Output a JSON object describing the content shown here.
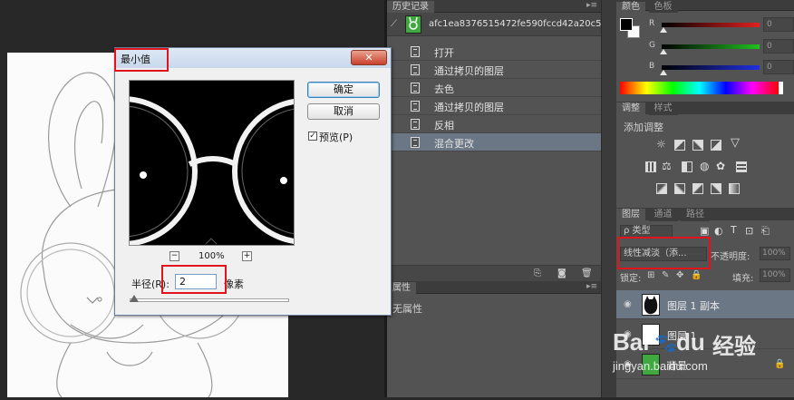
{
  "dialog": {
    "title": "最小值",
    "close_label": "✕",
    "ok_label": "确定",
    "cancel_label": "取消",
    "preview_label": "预览(P)",
    "preview_checked": true,
    "zoom_out": "−",
    "zoom_in": "+",
    "zoom_level": "100%",
    "radius_label": "半径(R):",
    "radius_value": "2",
    "radius_unit": "像素"
  },
  "history": {
    "tab_label": "历史记录",
    "snapshot_name": "afc1ea8376515472fe590fccd42a20c5_r...",
    "items": [
      {
        "label": "打开",
        "selected": false
      },
      {
        "label": "通过拷贝的图层",
        "selected": false
      },
      {
        "label": "去色",
        "selected": false
      },
      {
        "label": "通过拷贝的图层",
        "selected": false
      },
      {
        "label": "反相",
        "selected": false
      },
      {
        "label": "混合更改",
        "selected": true
      }
    ]
  },
  "properties": {
    "tab_label": "属性",
    "empty_text": "无属性"
  },
  "color_panel": {
    "tabs": [
      "颜色",
      "色板"
    ],
    "channels": [
      {
        "letter": "R",
        "value": "0",
        "color": "#e02020"
      },
      {
        "letter": "G",
        "value": "0",
        "color": "#20c020"
      },
      {
        "letter": "B",
        "value": "0",
        "color": "#2030e0"
      }
    ]
  },
  "adjustments": {
    "tabs": [
      "调整",
      "样式"
    ],
    "add_label": "添加调整"
  },
  "layers_panel": {
    "tabs": [
      "图层",
      "通道",
      "路径"
    ],
    "kind_filter": "ρ 类型",
    "blend_mode": "线性减淡（添...",
    "opacity_label": "不透明度:",
    "opacity_value": "100%",
    "lock_label": "锁定:",
    "fill_label": "填充:",
    "fill_value": "100%",
    "layers": [
      {
        "name": "图层 1 副本",
        "active": true
      },
      {
        "name": "图层 1",
        "active": false
      },
      {
        "name": "背景",
        "active": false
      }
    ]
  },
  "watermark": {
    "brand": "Bai",
    "brand2": "du",
    "service": "经验",
    "url": "jingyan.baidu.com"
  },
  "colors": {
    "highlight": "#e0141a",
    "panel_bg": "#535353",
    "selected_row": "#6b7785"
  }
}
